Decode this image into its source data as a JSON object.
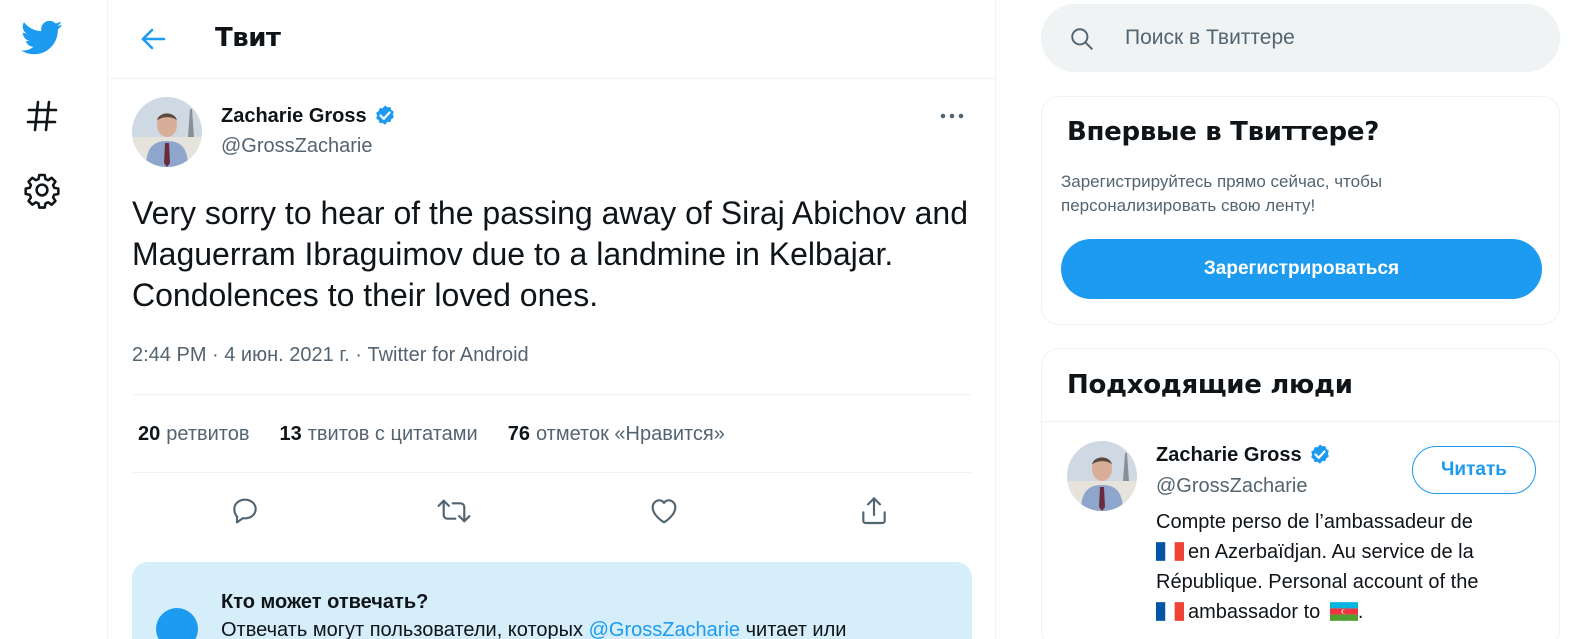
{
  "nav": {
    "icons": [
      "twitter-bird-icon",
      "hashtag-icon",
      "gear-icon"
    ]
  },
  "header": {
    "title": "Твит"
  },
  "tweet": {
    "author_name": "Zacharie Gross",
    "author_handle": "@GrossZacharie",
    "text": "Very sorry to hear of the passing away of Siraj Abichov and Maguerram Ibraguimov due to a landmine in Kelbajar. Condolences to their loved ones.",
    "meta": "2:44 PM · 4 июн. 2021 г. · Twitter for Android",
    "stats": {
      "retweets_count": "20",
      "retweets_label": "ретвитов",
      "quotes_count": "13",
      "quotes_label": "твитов с цитатами",
      "likes_count": "76",
      "likes_label": "отметок «Нравится»"
    },
    "actions": [
      "reply-icon",
      "retweet-icon",
      "like-icon",
      "share-icon"
    ]
  },
  "reply_notice": {
    "title": "Кто может отвечать?",
    "text_before": "Отвечать могут пользователи, которых ",
    "handle_link": "@GrossZacharie",
    "text_after": " читает или"
  },
  "sidebar": {
    "search_placeholder": "Поиск в Твиттере",
    "signup_card": {
      "title": "Впервые в Твиттере?",
      "description": "Зарегистрируйтесь прямо сейчас, чтобы персонализировать свою ленту!",
      "button_label": "Зарегистрироваться"
    },
    "people_card": {
      "title": "Подходящие люди",
      "name": "Zacharie Gross",
      "handle": "@GrossZacharie",
      "follow_label": "Читать",
      "bio_line1": "Compte perso de l’ambassadeur de",
      "bio_line2": "en Azerbaïdjan. Au service de la",
      "bio_line3": "République. Personal account of the",
      "bio_line4a": "ambassador to",
      "bio_line4b": "."
    }
  },
  "colors": {
    "accent": "#1d9bf0",
    "text_primary": "#0f1419",
    "text_secondary": "#536471",
    "border": "#eff3f4",
    "reply_bg": "#d5eef9"
  }
}
